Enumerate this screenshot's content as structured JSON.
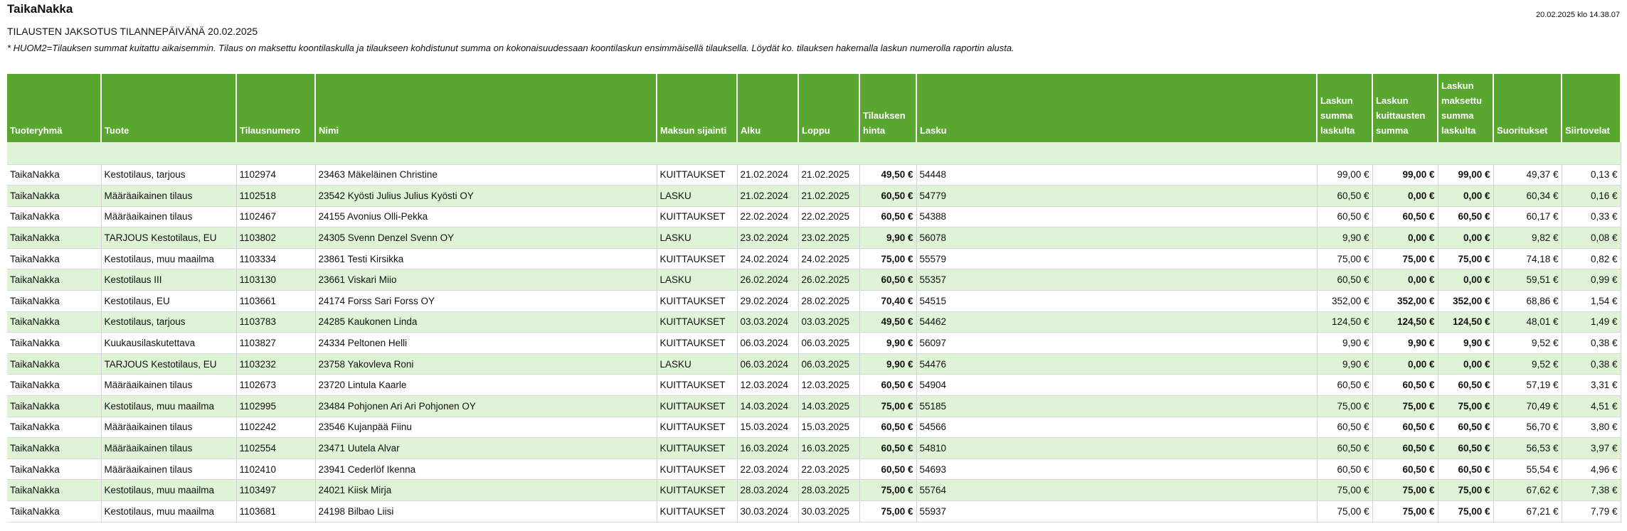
{
  "header": {
    "title": "TaikaNakka",
    "subtitle": "TILAUSTEN JAKSOTUS TILANNEPÄIVÄNÄ 20.02.2025",
    "note": "* HUOM2=Tilauksen summat kuitattu aikaisemmin. Tilaus on maksettu koontilaskulla ja tilaukseen kohdistunut summa on kokonaisuudessaan koontilaskun ensimmäisellä tilauksella. Löydät ko. tilauksen hakemalla laskun numerolla raportin alusta.",
    "timestamp": "20.02.2025 klo 14.38.07"
  },
  "columns": [
    "Tuoteryhmä",
    "Tuote",
    "Tilausnumero",
    "Nimi",
    "Maksun sijainti",
    "Alku",
    "Loppu",
    "Tilauksen hinta",
    "Lasku",
    "Laskun summa laskulta",
    "Laskun kuittausten summa",
    "Laskun maksettu summa laskulta",
    "Suoritukset",
    "Siirtovelat"
  ],
  "rows": [
    [
      "TaikaNakka",
      "Kestotilaus, tarjous",
      "1102974",
      "23463 Mäkeläinen Christine",
      "KUITTAUKSET",
      "21.02.2024",
      "21.02.2025",
      "49,50 €",
      "54448",
      "99,00 €",
      "99,00 €",
      "99,00 €",
      "49,37 €",
      "0,13 €"
    ],
    [
      "TaikaNakka",
      "Määräaikainen tilaus",
      "1102518",
      "23542 Kyösti Julius Julius Kyösti OY",
      "LASKU",
      "21.02.2024",
      "21.02.2025",
      "60,50 €",
      "54779",
      "60,50 €",
      "0,00 €",
      "0,00 €",
      "60,34 €",
      "0,16 €"
    ],
    [
      "TaikaNakka",
      "Määräaikainen tilaus",
      "1102467",
      "24155 Avonius Olli-Pekka",
      "KUITTAUKSET",
      "22.02.2024",
      "22.02.2025",
      "60,50 €",
      "54388",
      "60,50 €",
      "60,50 €",
      "60,50 €",
      "60,17 €",
      "0,33 €"
    ],
    [
      "TaikaNakka",
      "TARJOUS Kestotilaus, EU",
      "1103802",
      "24305 Svenn Denzel Svenn OY",
      "LASKU",
      "23.02.2024",
      "23.02.2025",
      "9,90 €",
      "56078",
      "9,90 €",
      "0,00 €",
      "0,00 €",
      "9,82 €",
      "0,08 €"
    ],
    [
      "TaikaNakka",
      "Kestotilaus, muu maailma",
      "1103334",
      "23861 Testi Kirsikka",
      "KUITTAUKSET",
      "24.02.2024",
      "24.02.2025",
      "75,00 €",
      "55579",
      "75,00 €",
      "75,00 €",
      "75,00 €",
      "74,18 €",
      "0,82 €"
    ],
    [
      "TaikaNakka",
      "Kestotilaus III",
      "1103130",
      "23661 Viskari Miio",
      "LASKU",
      "26.02.2024",
      "26.02.2025",
      "60,50 €",
      "55357",
      "60,50 €",
      "0,00 €",
      "0,00 €",
      "59,51 €",
      "0,99 €"
    ],
    [
      "TaikaNakka",
      "Kestotilaus, EU",
      "1103661",
      "24174 Forss Sari Forss OY",
      "KUITTAUKSET",
      "29.02.2024",
      "28.02.2025",
      "70,40 €",
      "54515",
      "352,00 €",
      "352,00 €",
      "352,00 €",
      "68,86 €",
      "1,54 €"
    ],
    [
      "TaikaNakka",
      "Kestotilaus, tarjous",
      "1103783",
      "24285 Kaukonen Linda",
      "KUITTAUKSET",
      "03.03.2024",
      "03.03.2025",
      "49,50 €",
      "54462",
      "124,50 €",
      "124,50 €",
      "124,50 €",
      "48,01 €",
      "1,49 €"
    ],
    [
      "TaikaNakka",
      "Kuukausilaskutettava",
      "1103827",
      "24334 Peltonen Helli",
      "KUITTAUKSET",
      "06.03.2024",
      "06.03.2025",
      "9,90 €",
      "56097",
      "9,90 €",
      "9,90 €",
      "9,90 €",
      "9,52 €",
      "0,38 €"
    ],
    [
      "TaikaNakka",
      "TARJOUS Kestotilaus, EU",
      "1103232",
      "23758 Yakovleva Roni",
      "LASKU",
      "06.03.2024",
      "06.03.2025",
      "9,90 €",
      "54476",
      "9,90 €",
      "0,00 €",
      "0,00 €",
      "9,52 €",
      "0,38 €"
    ],
    [
      "TaikaNakka",
      "Määräaikainen tilaus",
      "1102673",
      "23720 Lintula Kaarle",
      "KUITTAUKSET",
      "12.03.2024",
      "12.03.2025",
      "60,50 €",
      "54904",
      "60,50 €",
      "60,50 €",
      "60,50 €",
      "57,19 €",
      "3,31 €"
    ],
    [
      "TaikaNakka",
      "Kestotilaus, muu maailma",
      "1102995",
      "23484 Pohjonen Ari Ari Pohjonen OY",
      "KUITTAUKSET",
      "14.03.2024",
      "14.03.2025",
      "75,00 €",
      "55185",
      "75,00 €",
      "75,00 €",
      "75,00 €",
      "70,49 €",
      "4,51 €"
    ],
    [
      "TaikaNakka",
      "Määräaikainen tilaus",
      "1102242",
      "23546 Kujanpää Fiinu",
      "KUITTAUKSET",
      "15.03.2024",
      "15.03.2025",
      "60,50 €",
      "54566",
      "60,50 €",
      "60,50 €",
      "60,50 €",
      "56,70 €",
      "3,80 €"
    ],
    [
      "TaikaNakka",
      "Määräaikainen tilaus",
      "1102554",
      "23471 Uutela Alvar",
      "KUITTAUKSET",
      "16.03.2024",
      "16.03.2025",
      "60,50 €",
      "54810",
      "60,50 €",
      "60,50 €",
      "60,50 €",
      "56,53 €",
      "3,97 €"
    ],
    [
      "TaikaNakka",
      "Määräaikainen tilaus",
      "1102410",
      "23941 Cederlöf Ikenna",
      "KUITTAUKSET",
      "22.03.2024",
      "22.03.2025",
      "60,50 €",
      "54693",
      "60,50 €",
      "60,50 €",
      "60,50 €",
      "55,54 €",
      "4,96 €"
    ],
    [
      "TaikaNakka",
      "Kestotilaus, muu maailma",
      "1103497",
      "24021 Kiisk Mirja",
      "KUITTAUKSET",
      "28.03.2024",
      "28.03.2025",
      "75,00 €",
      "55764",
      "75,00 €",
      "75,00 €",
      "75,00 €",
      "67,62 €",
      "7,38 €"
    ],
    [
      "TaikaNakka",
      "Kestotilaus, muu maailma",
      "1103681",
      "24198 Bilbao Liisi",
      "KUITTAUKSET",
      "30.03.2024",
      "30.03.2025",
      "75,00 €",
      "55937",
      "75,00 €",
      "75,00 €",
      "75,00 €",
      "67,21 €",
      "7,79 €"
    ]
  ]
}
